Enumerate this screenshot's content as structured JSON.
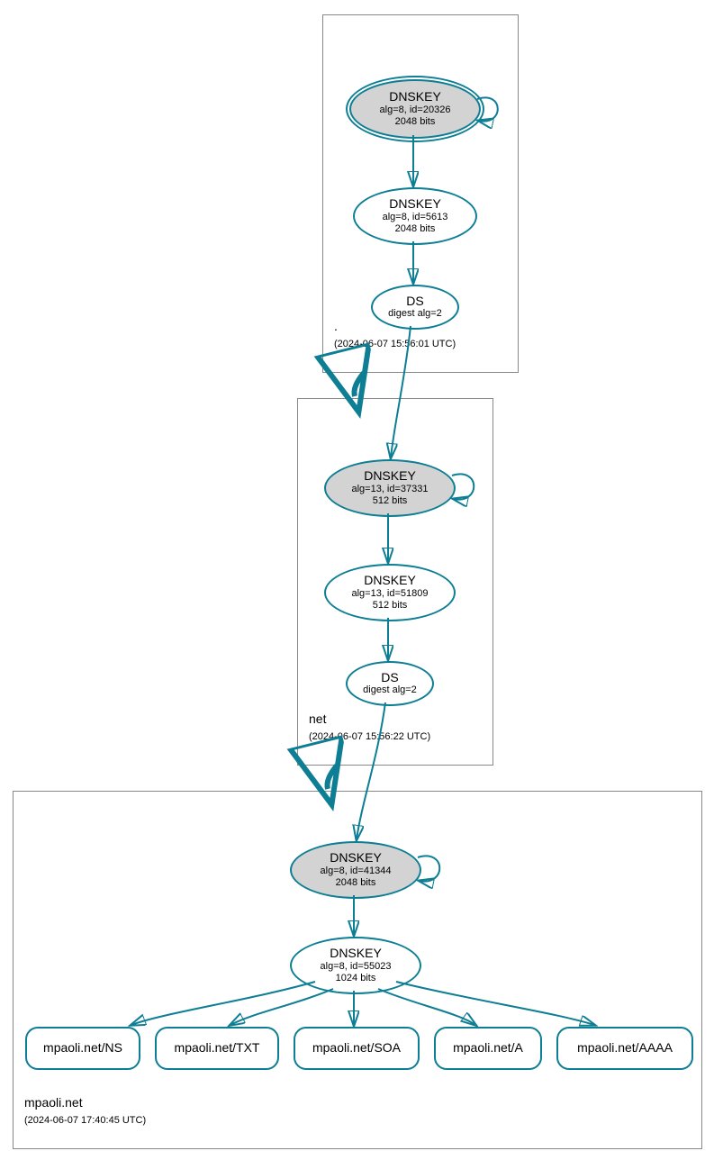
{
  "zones": {
    "root": {
      "name": ".",
      "timestamp": "(2024-06-07 15:56:01 UTC)"
    },
    "net": {
      "name": "net",
      "timestamp": "(2024-06-07 15:56:22 UTC)"
    },
    "mpaoli": {
      "name": "mpaoli.net",
      "timestamp": "(2024-06-07 17:40:45 UTC)"
    }
  },
  "nodes": {
    "root_ksk": {
      "title": "DNSKEY",
      "alg": "alg=8, id=20326",
      "bits": "2048 bits"
    },
    "root_zsk": {
      "title": "DNSKEY",
      "alg": "alg=8, id=5613",
      "bits": "2048 bits"
    },
    "root_ds": {
      "title": "DS",
      "alg": "digest alg=2"
    },
    "net_ksk": {
      "title": "DNSKEY",
      "alg": "alg=13, id=37331",
      "bits": "512 bits"
    },
    "net_zsk": {
      "title": "DNSKEY",
      "alg": "alg=13, id=51809",
      "bits": "512 bits"
    },
    "net_ds": {
      "title": "DS",
      "alg": "digest alg=2"
    },
    "mp_ksk": {
      "title": "DNSKEY",
      "alg": "alg=8, id=41344",
      "bits": "2048 bits"
    },
    "mp_zsk": {
      "title": "DNSKEY",
      "alg": "alg=8, id=55023",
      "bits": "1024 bits"
    }
  },
  "rrsets": {
    "ns": "mpaoli.net/NS",
    "txt": "mpaoli.net/TXT",
    "soa": "mpaoli.net/SOA",
    "a": "mpaoli.net/A",
    "aaaa": "mpaoli.net/AAAA"
  },
  "colors": {
    "accent": "#0d7e94",
    "ksk_fill": "#d3d3d3"
  }
}
